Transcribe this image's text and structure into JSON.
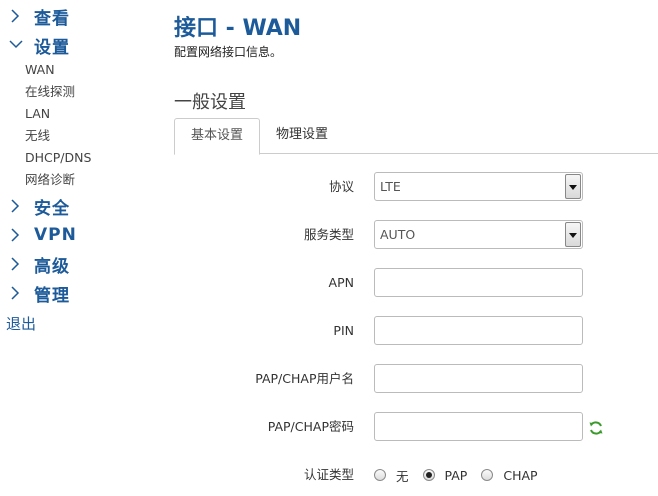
{
  "sidebar": {
    "top_items": [
      {
        "label": "查看"
      },
      {
        "label": "设置"
      },
      {
        "label": "安全"
      },
      {
        "label": "VPN"
      },
      {
        "label": "高级"
      },
      {
        "label": "管理"
      }
    ],
    "sub_items": [
      {
        "label": "WAN"
      },
      {
        "label": "在线探测"
      },
      {
        "label": "LAN"
      },
      {
        "label": "无线"
      },
      {
        "label": "DHCP/DNS"
      },
      {
        "label": "网络诊断"
      }
    ],
    "logout_label": "退出"
  },
  "main": {
    "title": "接口 - WAN",
    "description": "配置网络接口信息。",
    "section_title": "一般设置",
    "tabs": [
      {
        "label": "基本设置",
        "active": true
      },
      {
        "label": "物理设置",
        "active": false
      }
    ]
  },
  "form": {
    "protocol": {
      "label": "协议",
      "value": "LTE"
    },
    "service_type": {
      "label": "服务类型",
      "value": "AUTO"
    },
    "apn": {
      "label": "APN",
      "value": ""
    },
    "pin": {
      "label": "PIN",
      "value": ""
    },
    "username": {
      "label": "PAP/CHAP用户名",
      "value": ""
    },
    "password": {
      "label": "PAP/CHAP密码",
      "value": ""
    },
    "auth_type": {
      "label": "认证类型",
      "options": [
        {
          "label": "无",
          "checked": false
        },
        {
          "label": "PAP",
          "checked": true
        },
        {
          "label": "CHAP",
          "checked": false
        }
      ]
    }
  },
  "colors": {
    "accent": "#1c5a99",
    "refresh_icon": "#3a9a2a"
  },
  "icons": {
    "collapsed": "chevron-right-icon",
    "expanded": "chevron-down-icon",
    "password_toggle": "refresh-icon"
  }
}
